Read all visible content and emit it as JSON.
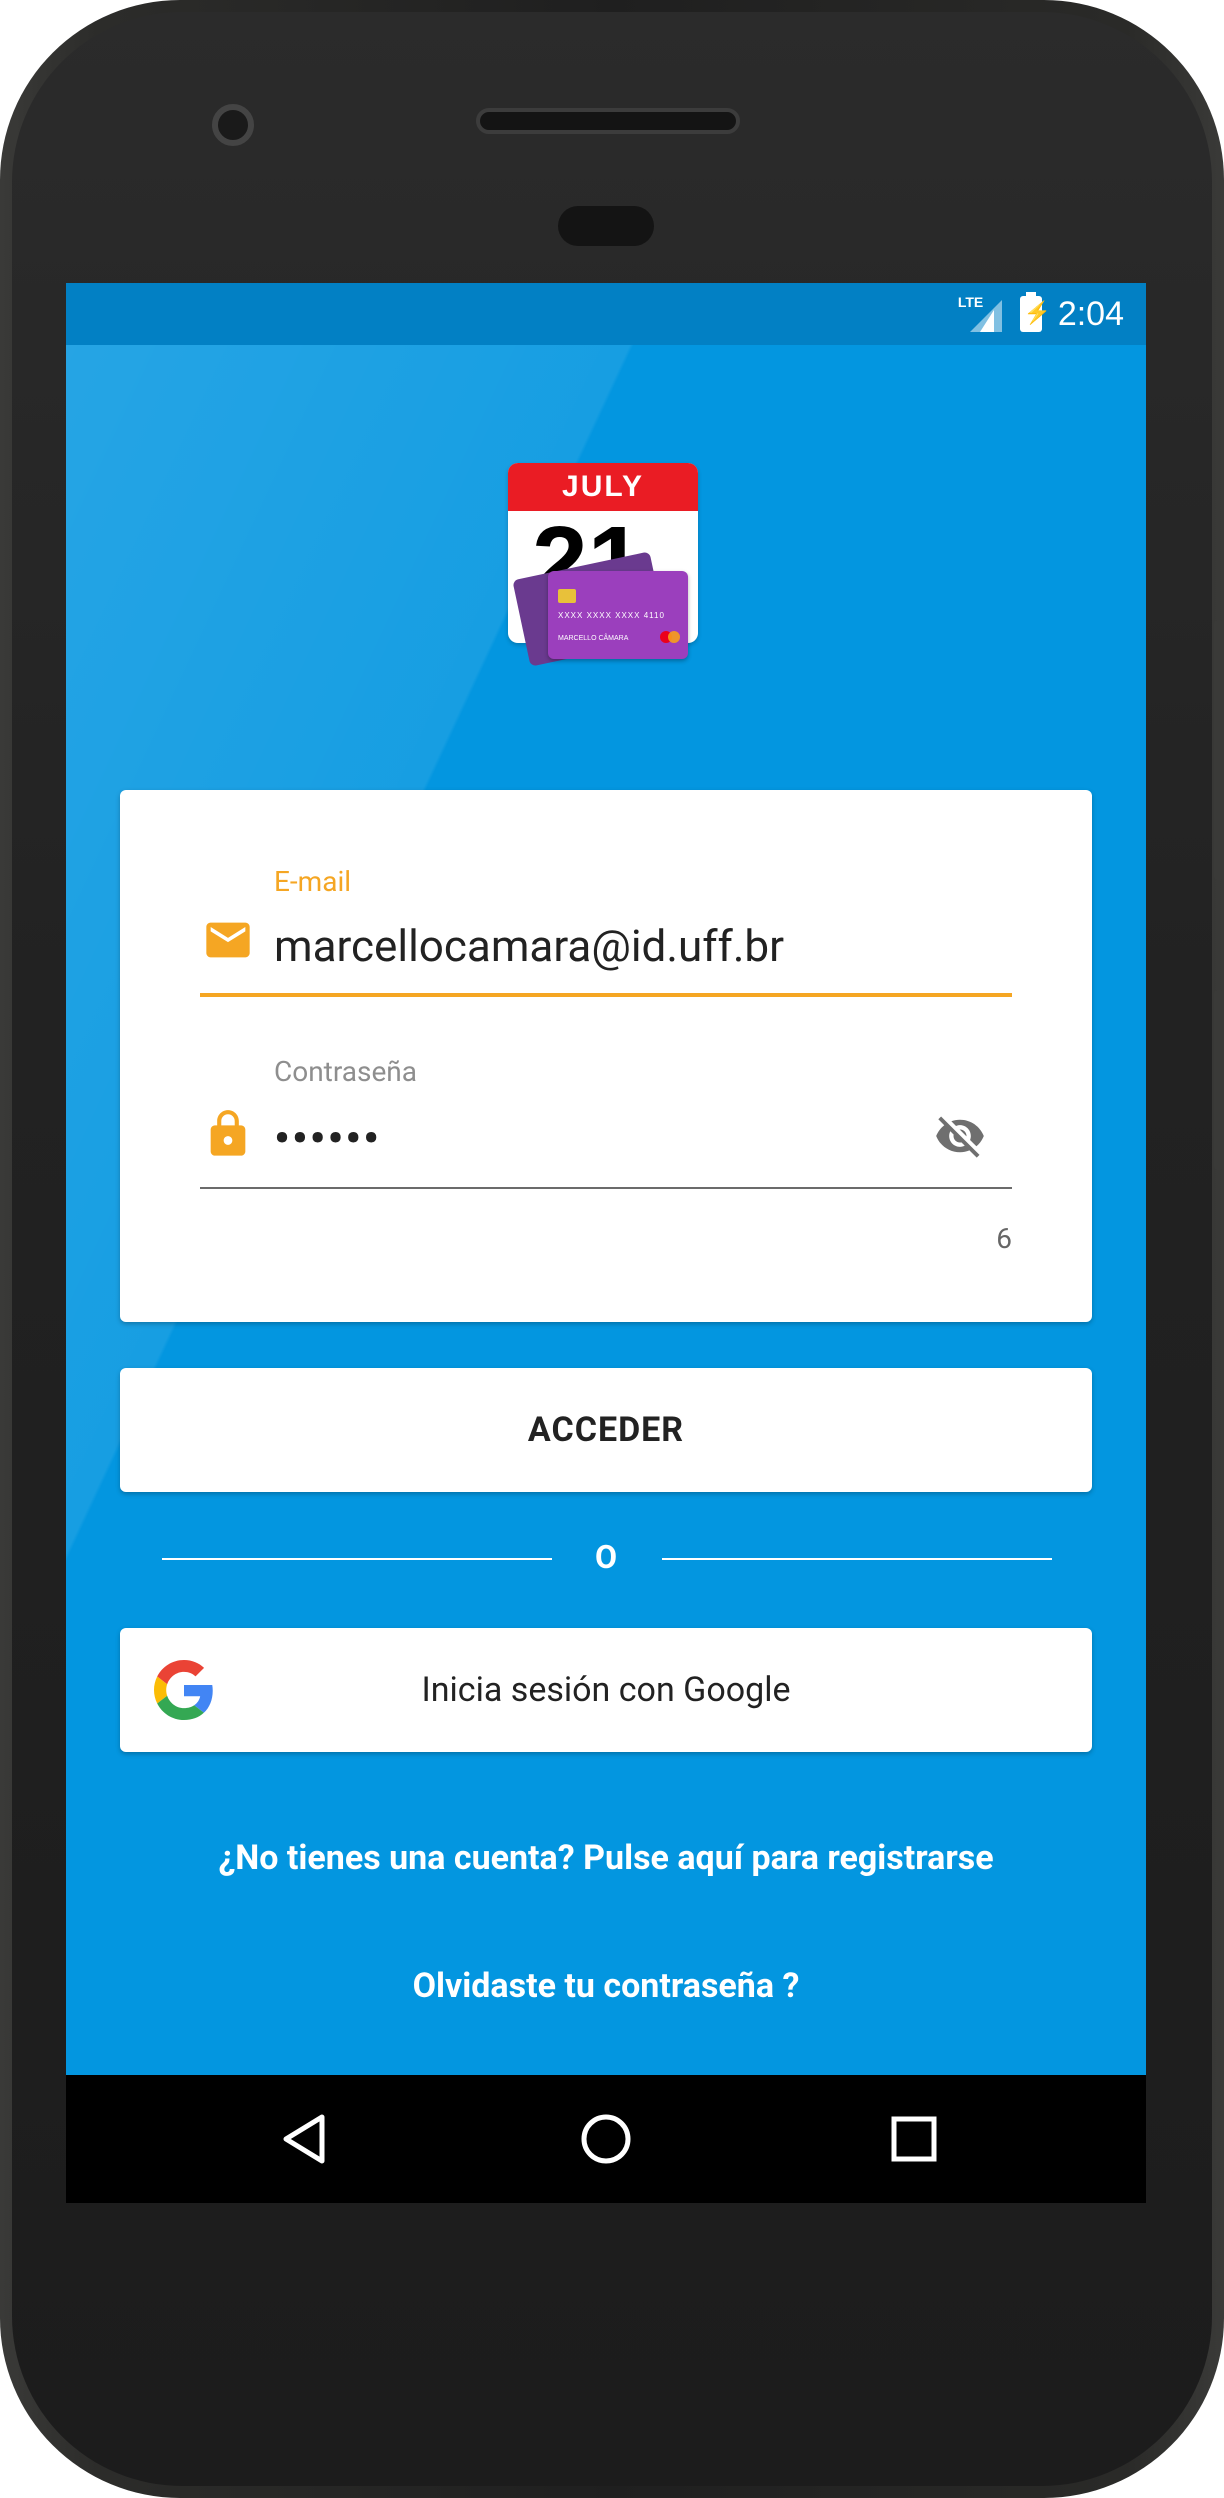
{
  "status_bar": {
    "network": "LTE",
    "time": "2:04"
  },
  "logo": {
    "month": "JULY",
    "day": "21",
    "card_number": "XXXX XXXX XXXX 4110",
    "card_name": "MARCELLO CÂMARA"
  },
  "login_form": {
    "email_label": "E-mail",
    "email_value": "marcellocamara@id.uff.br",
    "password_label": "Contraseña",
    "password_value": "••••••",
    "password_counter": "6"
  },
  "buttons": {
    "login_label": "ACCEDER",
    "divider_text": "O",
    "google_label": "Inicia sesión con Google"
  },
  "links": {
    "register": "¿No tienes una cuenta? Pulse aquí para registrarse",
    "forgot_password": "Olvidaste tu contraseña ?"
  },
  "icons": {
    "email": "mail-icon",
    "password": "lock-icon",
    "visibility": "eye-off-icon",
    "google": "google-g-icon",
    "nav": [
      "back-icon",
      "home-icon",
      "recents-icon"
    ]
  },
  "colors": {
    "background": "#0396e0",
    "status_bar": "#0280c4",
    "accent": "#f5a623",
    "calendar_red": "#ea1c24",
    "card_purple": "#9b3fbd"
  }
}
